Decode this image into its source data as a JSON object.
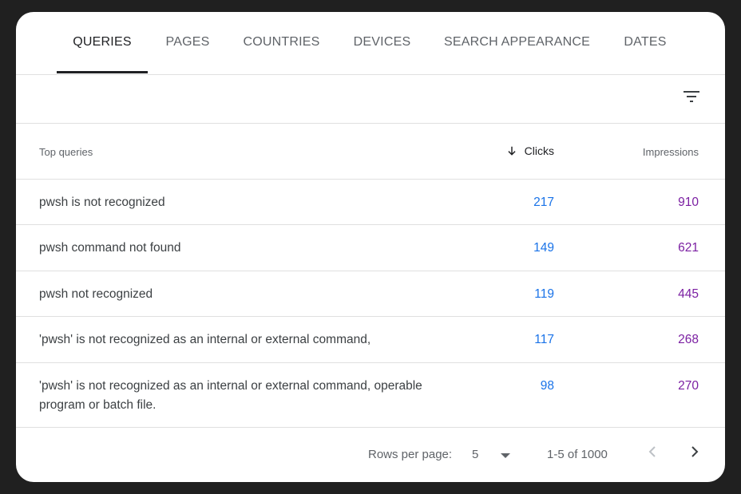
{
  "tabs": [
    {
      "label": "QUERIES",
      "active": true
    },
    {
      "label": "PAGES",
      "active": false
    },
    {
      "label": "COUNTRIES",
      "active": false
    },
    {
      "label": "DEVICES",
      "active": false
    },
    {
      "label": "SEARCH APPEARANCE",
      "active": false
    },
    {
      "label": "DATES",
      "active": false
    }
  ],
  "filter": {
    "icon": "filter-list-icon"
  },
  "table": {
    "headers": {
      "query": "Top queries",
      "clicks": "Clicks",
      "clicks_sort_icon": "arrow-downward-icon",
      "impressions": "Impressions"
    },
    "rows": [
      {
        "query": "pwsh is not recognized",
        "clicks": "217",
        "impressions": "910"
      },
      {
        "query": "pwsh command not found",
        "clicks": "149",
        "impressions": "621"
      },
      {
        "query": "pwsh not recognized",
        "clicks": "119",
        "impressions": "445"
      },
      {
        "query": "'pwsh' is not recognized as an internal or external command,",
        "clicks": "117",
        "impressions": "268"
      },
      {
        "query": "'pwsh' is not recognized as an internal or external command, operable program or batch file.",
        "clicks": "98",
        "impressions": "270"
      }
    ]
  },
  "pagination": {
    "rows_per_page_label": "Rows per page:",
    "rows_per_page_value": "5",
    "range_text": "1-5 of 1000",
    "prev_icon": "chevron-left-icon",
    "next_icon": "chevron-right-icon"
  },
  "colors": {
    "clicks": "#1a73e8",
    "impressions": "#7b1fa2",
    "background": "#202020",
    "card": "#ffffff"
  }
}
